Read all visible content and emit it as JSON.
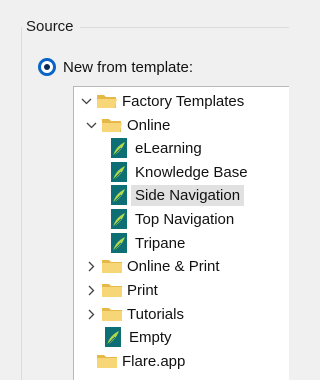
{
  "group": {
    "title": "Source"
  },
  "radio": {
    "label": "New from template:",
    "checked": true
  },
  "tree": {
    "nodes": [
      {
        "label": "Factory Templates",
        "kind": "folder",
        "state": "expanded",
        "selected": false
      },
      {
        "label": "Online",
        "kind": "folder",
        "state": "expanded",
        "selected": false
      },
      {
        "label": "eLearning",
        "kind": "template",
        "selected": false
      },
      {
        "label": "Knowledge Base",
        "kind": "template",
        "selected": false
      },
      {
        "label": "Side Navigation",
        "kind": "template",
        "selected": true
      },
      {
        "label": "Top Navigation",
        "kind": "template",
        "selected": false
      },
      {
        "label": "Tripane",
        "kind": "template",
        "selected": false
      },
      {
        "label": "Online & Print",
        "kind": "folder",
        "state": "collapsed",
        "selected": false
      },
      {
        "label": "Print",
        "kind": "folder",
        "state": "collapsed",
        "selected": false
      },
      {
        "label": "Tutorials",
        "kind": "folder",
        "state": "collapsed",
        "selected": false
      },
      {
        "label": "Empty",
        "kind": "template",
        "selected": false
      },
      {
        "label": "Flare.app",
        "kind": "folder",
        "state": "leaf",
        "selected": false
      }
    ]
  },
  "colors": {
    "radio_accent": "#0a64c8",
    "selection": "#e1e1e1",
    "folder_yellow": "#f3cf63",
    "template_teal": "#0d6f73",
    "template_green": "#b7d84a"
  }
}
